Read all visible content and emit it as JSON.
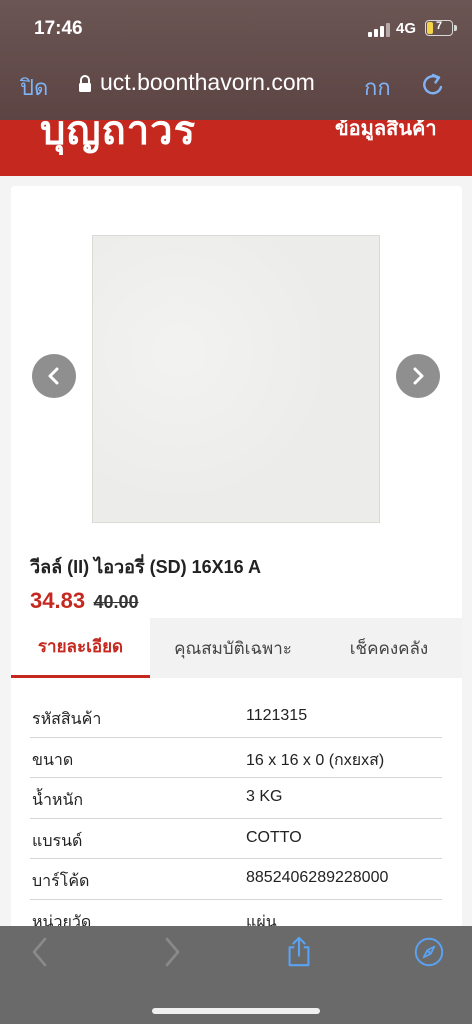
{
  "status_bar": {
    "time": "17:46",
    "network": "4G",
    "battery": "7"
  },
  "browser": {
    "close_label": "ปิด",
    "url": "uct.boonthavorn.com",
    "text_size_label": "กก"
  },
  "site_header": {
    "logo_text": "บุญถาวร",
    "menu_text": "ข้อมูลสินค้า",
    "color": "#c5281f"
  },
  "product": {
    "name": "วีลล์ (II) ไอวอรี่ (SD) 16X16 A",
    "sale_price": "34.83",
    "original_price": "40.00"
  },
  "tabs": [
    {
      "label": "รายละเอียด",
      "active": true
    },
    {
      "label": "คุณสมบัติเฉพาะ",
      "active": false
    },
    {
      "label": "เช็คคงคลัง",
      "active": false
    }
  ],
  "specs": [
    {
      "label": "รหัสสินค้า",
      "value": "1121315"
    },
    {
      "label": "ขนาด",
      "value": "16 x 16 x 0 (กxยxส)"
    },
    {
      "label": "น้ำหนัก",
      "value": "3 KG"
    },
    {
      "label": "แบรนด์",
      "value": "COTTO"
    },
    {
      "label": "บาร์โค้ด",
      "value": "8852406289228000"
    },
    {
      "label": "หน่วยวัด",
      "value": "แผ่น"
    }
  ],
  "toolbar_icons": [
    "back-icon",
    "forward-icon",
    "share-icon",
    "compass-icon"
  ]
}
